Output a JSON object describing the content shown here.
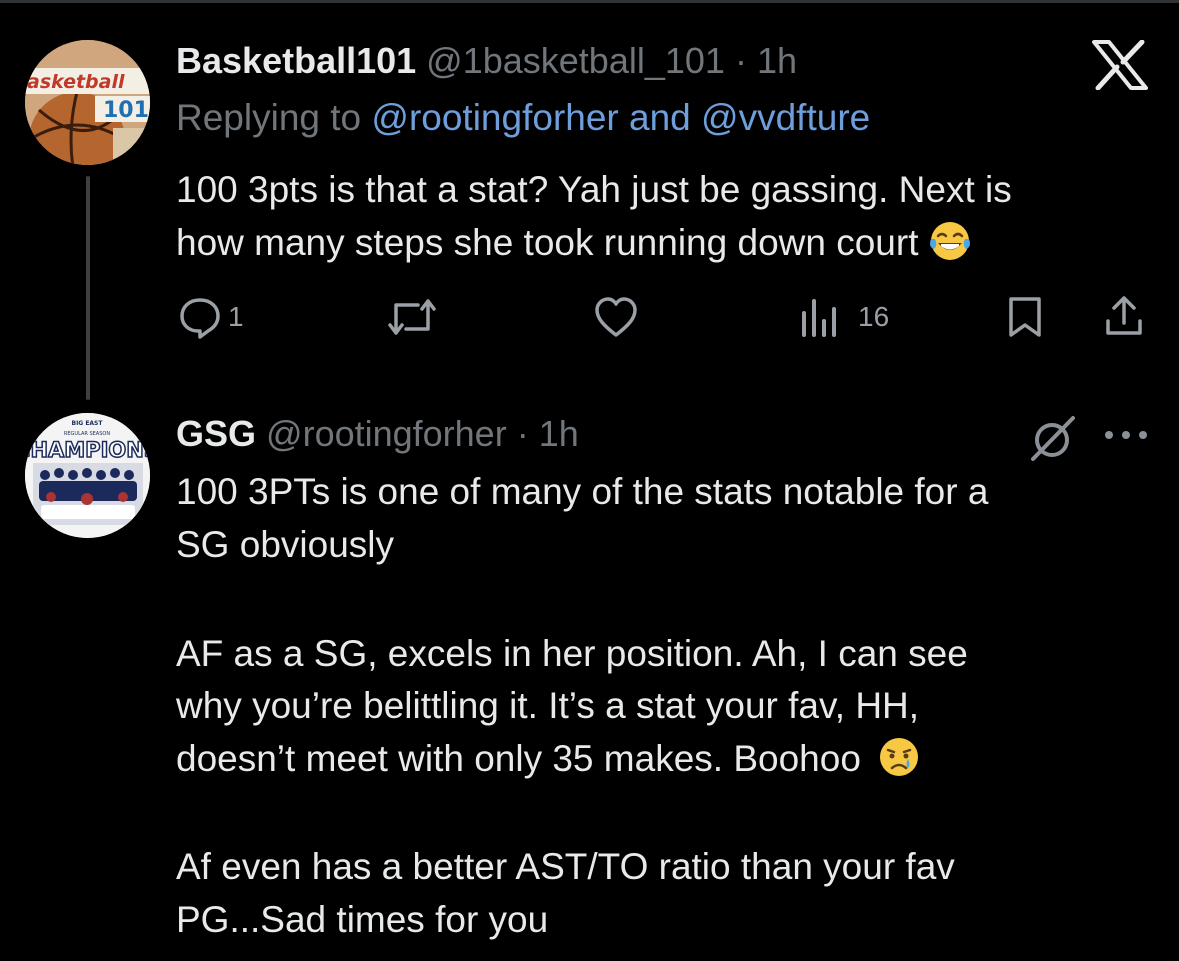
{
  "tweet1": {
    "avatar_text_line1": "asketball",
    "avatar_text_line2": "101",
    "display_name": "Basketball101",
    "handle": "@1basketball_101",
    "separator": "·",
    "time": "1h",
    "replying_prefix": "Replying to",
    "reply_to_1": "@rootingforher",
    "reply_and": "and",
    "reply_to_2": "@vvdfture",
    "text_line1": "100 3pts is that a stat? Yah just be gassing. Next is",
    "text_line2": "how many steps she took running down court",
    "emoji": "laughing-tears",
    "actions": {
      "reply_count": "1",
      "repost_count": "",
      "like_count": "",
      "views_count": "16"
    }
  },
  "tweet2": {
    "avatar_text_small": "BIG EAST",
    "avatar_text_sub": "REGULAR SEASON",
    "avatar_text_main": "CHAMPIONS",
    "display_name": "GSG",
    "handle": "@rootingforher",
    "separator": "·",
    "time": "1h",
    "text_line1": "100 3PTs is one of many of the stats notable for a",
    "text_line2": "SG obviously",
    "text_line3": "AF as a SG, excels in her position. Ah, I can see",
    "text_line4": "why you’re belittling it. It’s a stat your fav, HH,",
    "text_line5": "doesn’t meet with only 35 makes. Boohoo",
    "text_line6": "Af even has a better AST/TO ratio than your fav",
    "text_line7": "PG...Sad times for you",
    "emoji": "crying-face"
  },
  "colors": {
    "background": "#000000",
    "text": "#e7e9ea",
    "muted": "#71767b",
    "link": "#6e9fdc"
  }
}
